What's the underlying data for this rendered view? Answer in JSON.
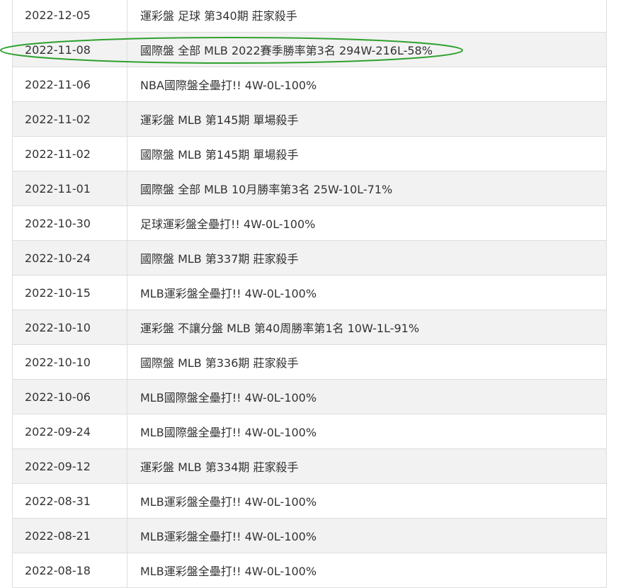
{
  "table": {
    "rows": [
      {
        "date": "2022-12-05",
        "desc": "運彩盤 足球 第340期 莊家殺手"
      },
      {
        "date": "2022-11-08",
        "desc": "國際盤 全部 MLB 2022賽季勝率第3名 294W-216L-58%"
      },
      {
        "date": "2022-11-06",
        "desc": "NBA國際盤全壘打!! 4W-0L-100%"
      },
      {
        "date": "2022-11-02",
        "desc": "運彩盤 MLB 第145期 單場殺手"
      },
      {
        "date": "2022-11-02",
        "desc": "國際盤 MLB 第145期 單場殺手"
      },
      {
        "date": "2022-11-01",
        "desc": "國際盤 全部 MLB 10月勝率第3名 25W-10L-71%"
      },
      {
        "date": "2022-10-30",
        "desc": "足球運彩盤全壘打!! 4W-0L-100%"
      },
      {
        "date": "2022-10-24",
        "desc": "國際盤 MLB 第337期 莊家殺手"
      },
      {
        "date": "2022-10-15",
        "desc": "MLB運彩盤全壘打!! 4W-0L-100%"
      },
      {
        "date": "2022-10-10",
        "desc": "運彩盤 不讓分盤 MLB 第40周勝率第1名 10W-1L-91%"
      },
      {
        "date": "2022-10-10",
        "desc": "國際盤 MLB 第336期 莊家殺手"
      },
      {
        "date": "2022-10-06",
        "desc": "MLB國際盤全壘打!! 4W-0L-100%"
      },
      {
        "date": "2022-09-24",
        "desc": "MLB國際盤全壘打!! 4W-0L-100%"
      },
      {
        "date": "2022-09-12",
        "desc": "運彩盤 MLB 第334期 莊家殺手"
      },
      {
        "date": "2022-08-31",
        "desc": "MLB運彩盤全壘打!! 4W-0L-100%"
      },
      {
        "date": "2022-08-21",
        "desc": "MLB運彩盤全壘打!! 4W-0L-100%"
      },
      {
        "date": "2022-08-18",
        "desc": "MLB運彩盤全壘打!! 4W-0L-100%"
      }
    ]
  },
  "annotation": {
    "highlighted_row": 1,
    "color": "#2ea02e"
  },
  "colors": {
    "text": "#333333",
    "stripe": "#f2f2f2",
    "border": "#dddddd"
  }
}
